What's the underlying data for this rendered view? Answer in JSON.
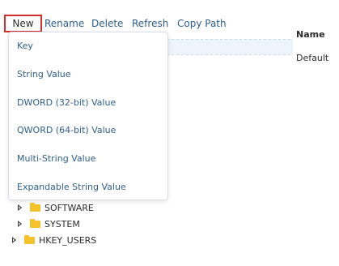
{
  "toolbar": {
    "new_label": "New",
    "rename_label": "Rename",
    "delete_label": "Delete",
    "refresh_label": "Refresh",
    "copy_path_label": "Copy Path"
  },
  "details": {
    "column_name": "Name",
    "row_name": "Default"
  },
  "new_menu": {
    "items": [
      {
        "label": "Key"
      },
      {
        "label": "String Value"
      },
      {
        "label": "DWORD (32-bit) Value"
      },
      {
        "label": "QWORD (64-bit) Value"
      },
      {
        "label": "Multi-String Value"
      },
      {
        "label": "Expandable String Value"
      }
    ]
  },
  "tree": {
    "items": [
      {
        "label": "SOFTWARE",
        "icon": "folder-icon"
      },
      {
        "label": "SYSTEM",
        "icon": "folder-icon"
      },
      {
        "label": "HKEY_USERS",
        "icon": "folder-icon"
      }
    ]
  },
  "colors": {
    "accent_link": "#2e5f8c",
    "highlight_border": "#d32f2f",
    "folder": "#f4c22b",
    "selection_row": "#edf4fc"
  }
}
